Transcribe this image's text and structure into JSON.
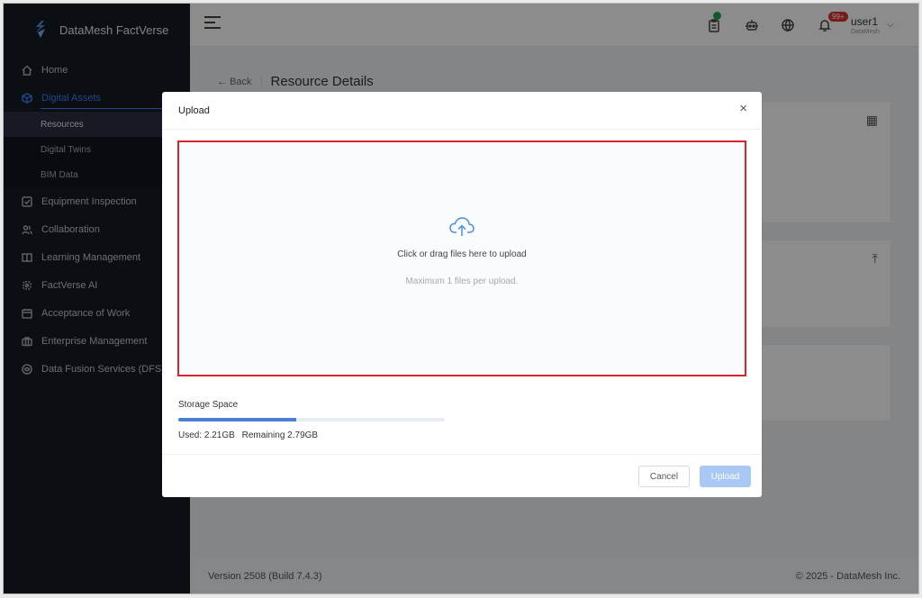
{
  "brand": {
    "name": "DataMesh FactVerse"
  },
  "sidebar": {
    "items": [
      {
        "label": "Home",
        "icon": "home-icon"
      },
      {
        "label": "Digital Assets",
        "icon": "cube-icon",
        "active": true
      },
      {
        "label": "Equipment Inspection",
        "icon": "checkbox-icon"
      },
      {
        "label": "Collaboration",
        "icon": "users-icon"
      },
      {
        "label": "Learning Management",
        "icon": "book-icon"
      },
      {
        "label": "FactVerse AI",
        "icon": "ai-icon"
      },
      {
        "label": "Acceptance of Work",
        "icon": "calendar-icon"
      },
      {
        "label": "Enterprise Management",
        "icon": "briefcase-icon"
      },
      {
        "label": "Data Fusion Services (DFS)",
        "icon": "dfs-icon"
      }
    ],
    "sub_items": [
      {
        "label": "Resources",
        "selected": true
      },
      {
        "label": "Digital Twins"
      },
      {
        "label": "BIM Data"
      }
    ]
  },
  "header": {
    "notification_badge": "99+",
    "user_name": "user1",
    "user_org": "DataMesh"
  },
  "content": {
    "back_label": "Back",
    "page_title": "Resource Details"
  },
  "footer": {
    "version": "Version 2508 (Build 7.4.3)",
    "copyright": "© 2025 - DataMesh Inc."
  },
  "modal": {
    "title": "Upload",
    "close_label": "×",
    "drop_text": "Click or drag files here to upload",
    "drop_sub": "Maximum 1 files per upload.",
    "storage_title": "Storage Space",
    "storage_used_fraction": 0.442,
    "used_label": "Used: 2.21GB",
    "remaining_label": "Remaining 2.79GB",
    "cancel_label": "Cancel",
    "upload_label": "Upload"
  },
  "colors": {
    "accent": "#3b82f6",
    "sidebar_bg": "#141a24",
    "highlight_border": "#d9232e",
    "progress_fill": "#4a7fd4",
    "upload_button_disabled": "#a9c8f4"
  }
}
